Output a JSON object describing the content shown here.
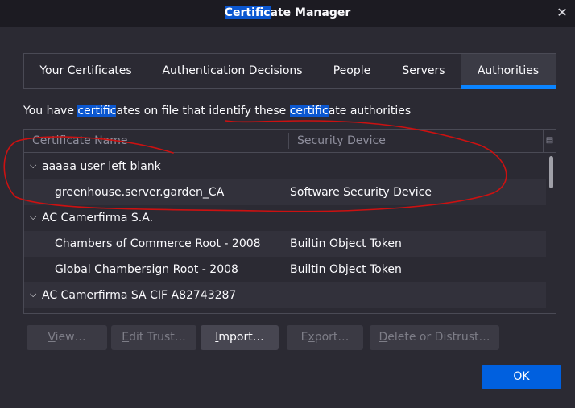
{
  "window": {
    "title_highlight": "Certific",
    "title_rest": "ate Manager",
    "close_glyph": "✕"
  },
  "tabs": [
    {
      "label": "Your Certificates",
      "active": false
    },
    {
      "label": "Authentication Decisions",
      "active": false
    },
    {
      "label": "People",
      "active": false
    },
    {
      "label": "Servers",
      "active": false
    },
    {
      "label": "Authorities",
      "active": true
    }
  ],
  "description": {
    "part1": "You have ",
    "hl1": "certific",
    "part2": "ates on file that identify these ",
    "hl2": "certific",
    "part3": "ate authorities"
  },
  "table": {
    "columns": [
      "Certificate Name",
      "Security Device"
    ],
    "rows": [
      {
        "type": "group",
        "name": "aaaaa user left blank",
        "device": ""
      },
      {
        "type": "child",
        "name": "greenhouse.server.garden_CA",
        "device": "Software Security Device"
      },
      {
        "type": "group",
        "name": "AC Camerfirma S.A.",
        "device": ""
      },
      {
        "type": "child",
        "name": "Chambers of Commerce Root - 2008",
        "device": "Builtin Object Token"
      },
      {
        "type": "child",
        "name": "Global Chambersign Root - 2008",
        "device": "Builtin Object Token"
      },
      {
        "type": "group",
        "name": "AC Camerfirma SA CIF A82743287",
        "device": ""
      }
    ]
  },
  "buttons": {
    "view": {
      "u": "V",
      "rest": "iew…",
      "enabled": false
    },
    "edit": {
      "u": "E",
      "rest": "dit Trust…",
      "enabled": false
    },
    "import": {
      "u": "I",
      "rest": "mport…",
      "enabled": true
    },
    "export": {
      "u": "x",
      "pre": "E",
      "rest": "port…",
      "enabled": false
    },
    "delete": {
      "u": "D",
      "rest": "elete or Distrust…",
      "enabled": false
    },
    "ok": "OK"
  },
  "annotation_color": "#cc1111"
}
